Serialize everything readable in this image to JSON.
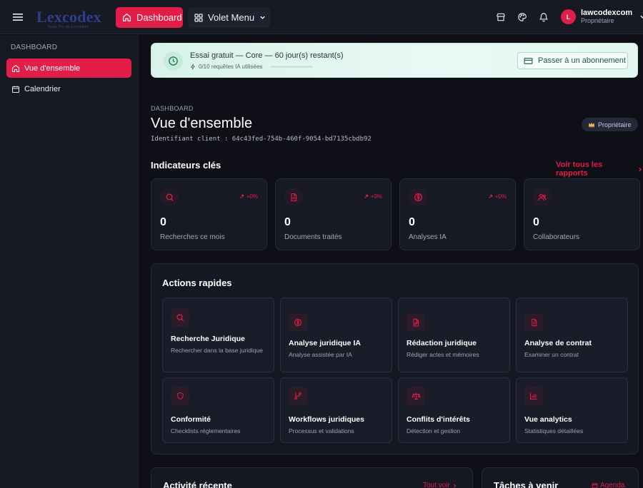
{
  "brand": {
    "logo_text": "Lexcodex",
    "logo_tagline": "Suite Pro de Lexcodex"
  },
  "topbar": {
    "dashboard_label": "Dashboard",
    "volet_label": "Volet Menu",
    "user_initial": "L",
    "user_name": "lawcodexcom",
    "user_role": "Propriétaire"
  },
  "sidebar": {
    "section": "DASHBOARD",
    "items": [
      {
        "label": "Vue d'ensemble",
        "active": true
      },
      {
        "label": "Calendrier",
        "active": false
      }
    ]
  },
  "trial": {
    "title": "Essai gratuit — Core — 60 jour(s) restant(s)",
    "usage": "0/10 requêtes IA utilisées",
    "usage_fraction": 0.0,
    "button": "Passer à un abonnement"
  },
  "header": {
    "breadcrumb": "DASHBOARD",
    "title": "Vue d'ensemble",
    "client_id": "Identifiant client : 64c43fed-754b-460f-9054-bd7135cbdb92",
    "badge": "Propriétaire"
  },
  "kpis": {
    "title": "Indicateurs clés",
    "see_all": "Voir tous les rapports",
    "items": [
      {
        "icon": "search-icon",
        "delta": "+0%",
        "value": "0",
        "label": "Recherches ce mois"
      },
      {
        "icon": "document-icon",
        "delta": "+0%",
        "value": "0",
        "label": "Documents traités"
      },
      {
        "icon": "brain-icon",
        "delta": "+0%",
        "value": "0",
        "label": "Analyses IA"
      },
      {
        "icon": "users-icon",
        "delta": "",
        "value": "0",
        "label": "Collaborateurs"
      }
    ]
  },
  "actions": {
    "title": "Actions rapides",
    "items": [
      {
        "icon": "search-icon",
        "title": "Recherche Juridique",
        "desc": "Rechercher dans la base juridique"
      },
      {
        "icon": "brain-icon",
        "title": "Analyse juridique IA",
        "desc": "Analyse assistée par IA"
      },
      {
        "icon": "file-pen-icon",
        "title": "Rédaction juridique",
        "desc": "Rédiger actes et mémoires"
      },
      {
        "icon": "document-icon",
        "title": "Analyse de contrat",
        "desc": "Examiner un contrat"
      },
      {
        "icon": "shield-icon",
        "title": "Conformité",
        "desc": "Checklists réglementaires"
      },
      {
        "icon": "git-branch-icon",
        "title": "Workflows juridiques",
        "desc": "Processus et validations"
      },
      {
        "icon": "scale-icon",
        "title": "Conflits d'intérêts",
        "desc": "Détection et gestion"
      },
      {
        "icon": "bar-chart-icon",
        "title": "Vue analytics",
        "desc": "Statistiques détaillées"
      }
    ]
  },
  "activity": {
    "title": "Activité récente",
    "link": "Tout voir"
  },
  "tasks": {
    "title": "Tâches à venir",
    "link": "Agenda"
  },
  "colors": {
    "accent": "#e11d48",
    "background": "#0e0f17",
    "card": "#171a25"
  }
}
